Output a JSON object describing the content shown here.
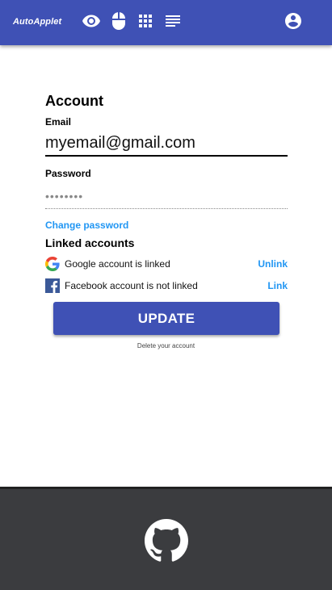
{
  "header": {
    "logo_text": "AutoApplet",
    "icons": [
      "eye-icon",
      "mouse-icon",
      "apps-grid-icon",
      "list-icon",
      "account-circle-icon"
    ]
  },
  "account": {
    "title": "Account",
    "email_label": "Email",
    "email_value": "myemail@gmail.com",
    "password_label": "Password",
    "password_value": "••••••••",
    "change_password": "Change password"
  },
  "linked_accounts": {
    "title": "Linked accounts",
    "items": [
      {
        "provider_icon": "google-icon",
        "status": "Google account is linked",
        "action": "Unlink"
      },
      {
        "provider_icon": "facebook-icon",
        "status": "Facebook account is not linked",
        "action": "Link"
      }
    ]
  },
  "actions": {
    "update_label": "UPDATE",
    "delete_label": "Delete your account"
  },
  "footer": {
    "icon": "github-icon"
  },
  "colors": {
    "primary": "#3f51b5",
    "link": "#2196f3",
    "footer_bg": "#3b3c3f"
  }
}
